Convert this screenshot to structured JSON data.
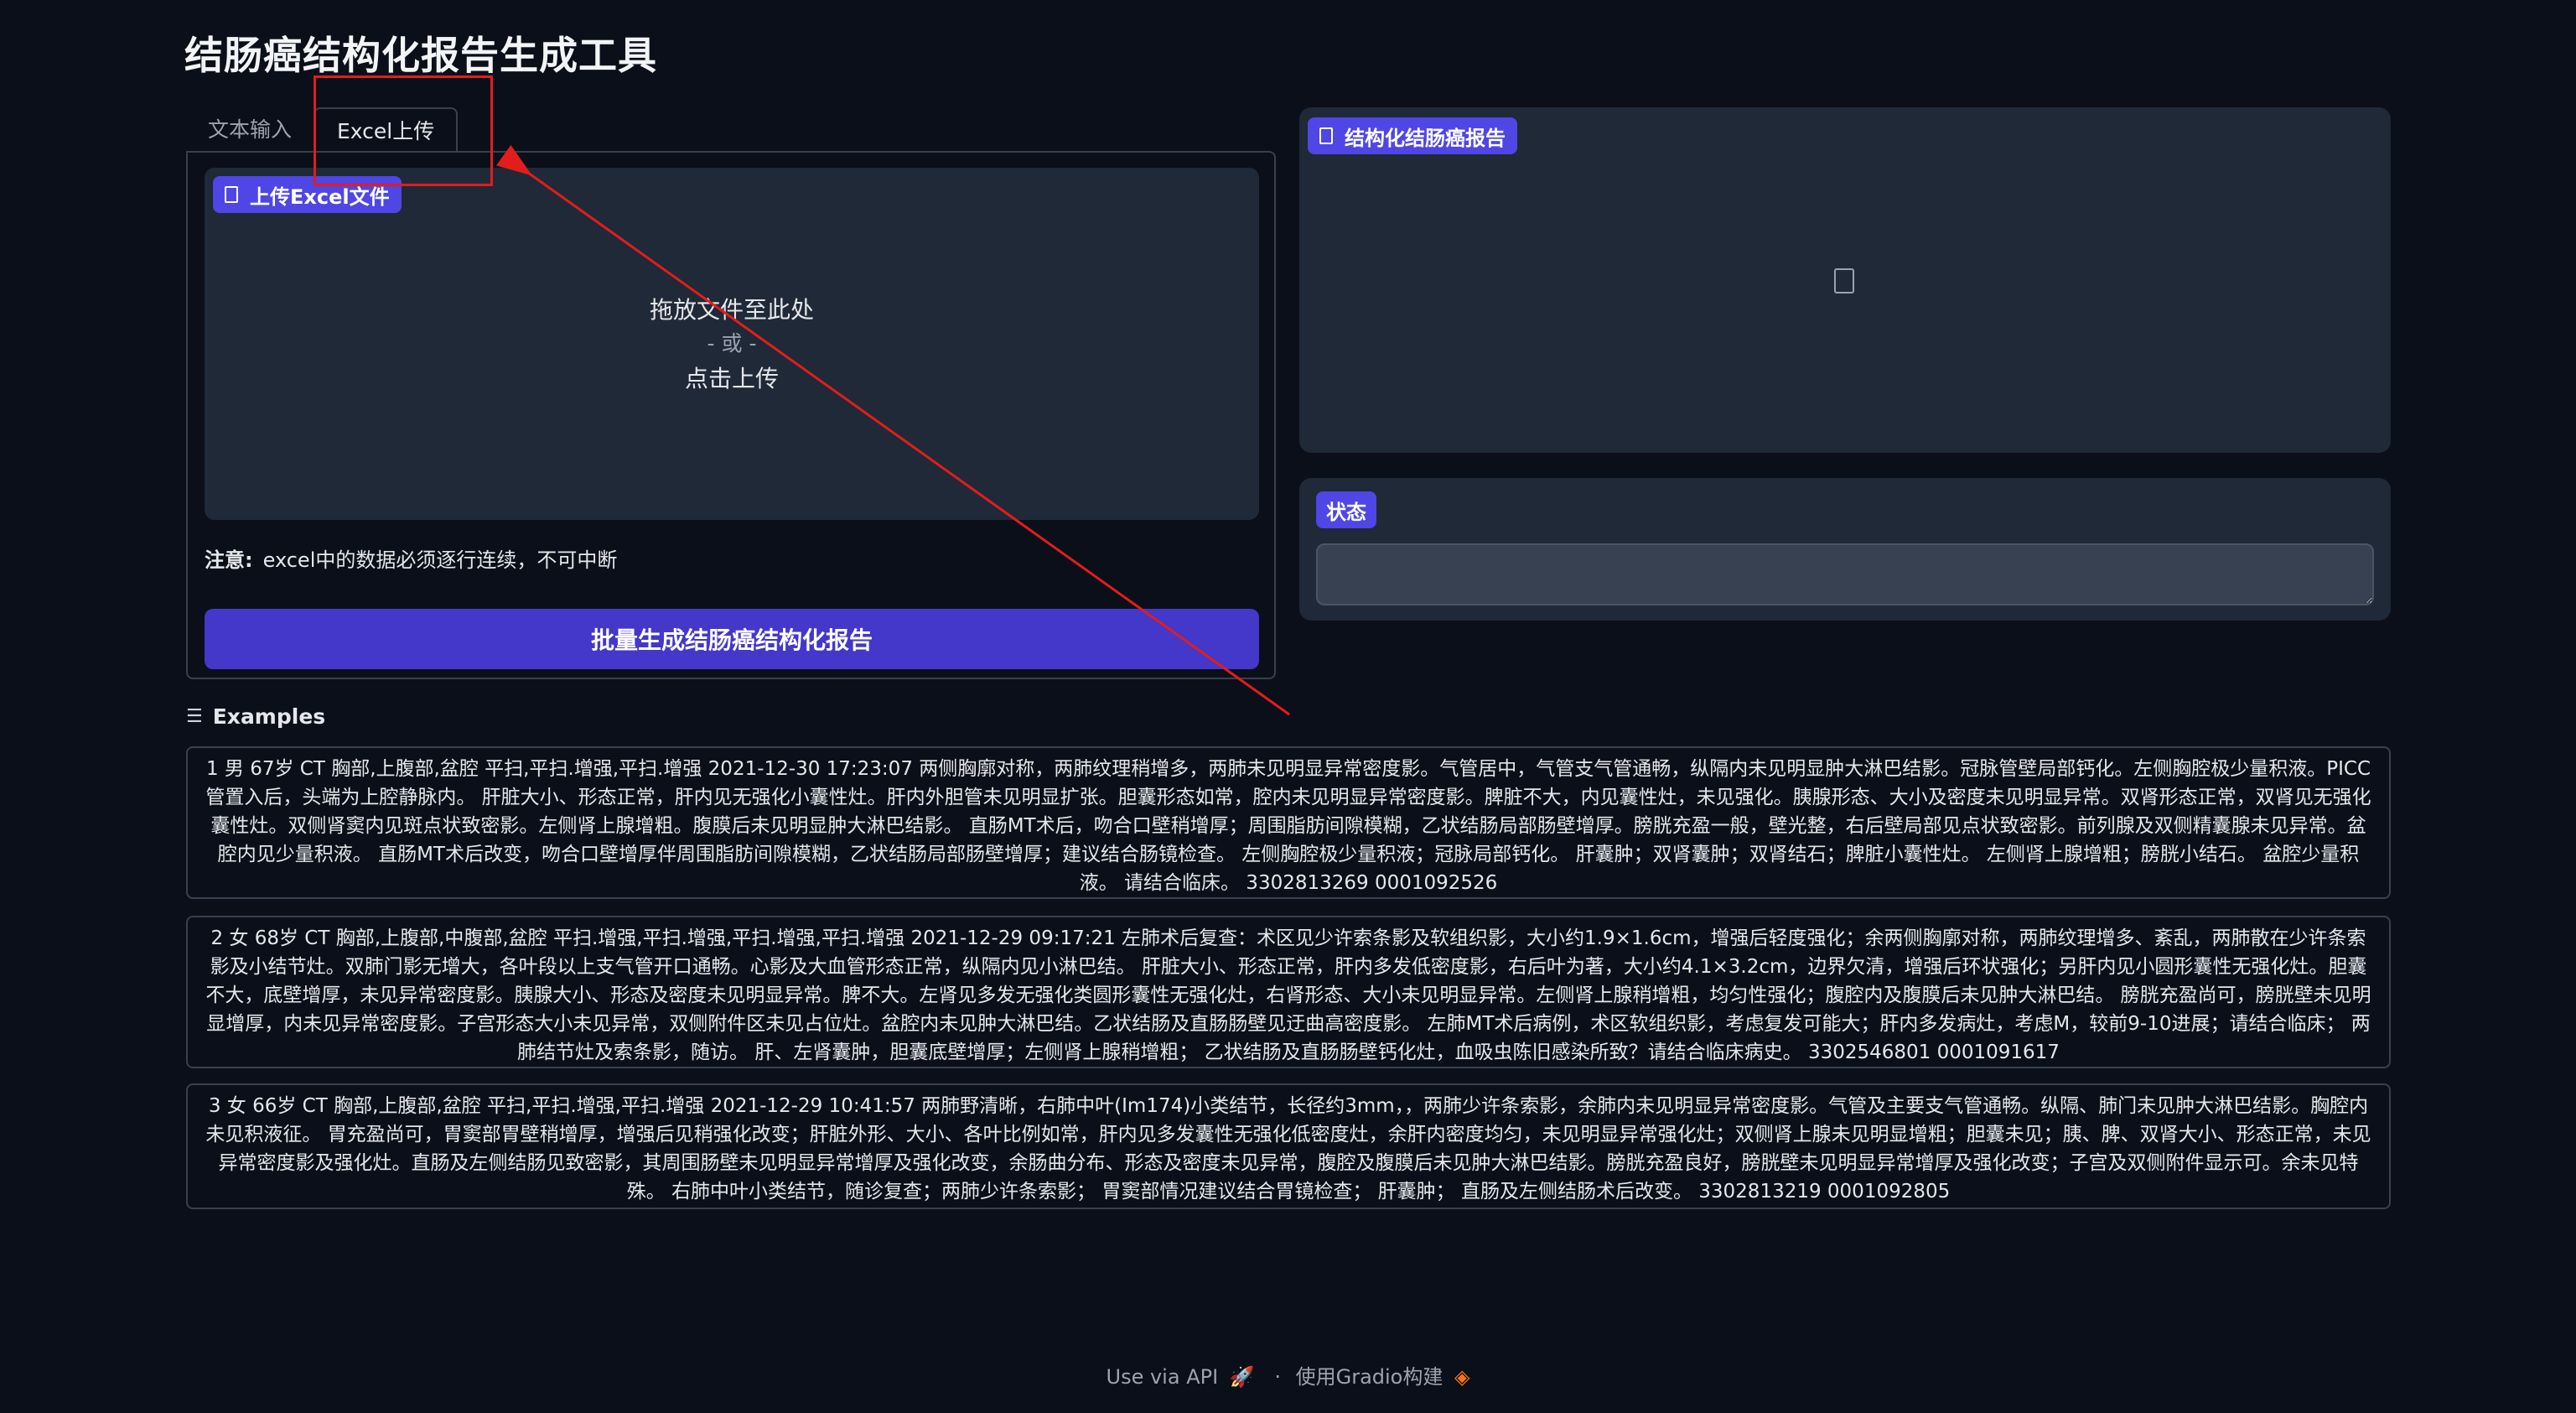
{
  "app": {
    "title": "结肠癌结构化报告生成工具"
  },
  "tabs": [
    {
      "label": "文本输入",
      "active": false
    },
    {
      "label": "Excel上传",
      "active": true
    }
  ],
  "upload": {
    "label": "上传Excel文件",
    "drop_text": "拖放文件至此处",
    "or_text": "- 或 -",
    "click_text": "点击上传"
  },
  "note": {
    "prefix": "注意:",
    "text": "excel中的数据必须逐行连续，不可中断"
  },
  "generate_button": "批量生成结肠癌结构化报告",
  "report": {
    "label": "结构化结肠癌报告"
  },
  "status": {
    "label": "状态",
    "value": ""
  },
  "examples": {
    "heading": "Examples",
    "items": [
      "1 男 67岁 CT 胸部,上腹部,盆腔 平扫,平扫.增强,平扫.增强 2021-12-30 17:23:07 两侧胸廓对称，两肺纹理稍增多，两肺未见明显异常密度影。气管居中，气管支气管通畅，纵隔内未见明显肿大淋巴结影。冠脉管壁局部钙化。左侧胸腔极少量积液。PICC管置入后，头端为上腔静脉内。 肝脏大小、形态正常，肝内见无强化小囊性灶。肝内外胆管未见明显扩张。胆囊形态如常，腔内未见明显异常密度影。脾脏不大，内见囊性灶，未见强化。胰腺形态、大小及密度未见明显异常。双肾形态正常，双肾见无强化囊性灶。双侧肾窦内见斑点状致密影。左侧肾上腺增粗。腹膜后未见明显肿大淋巴结影。 直肠MT术后，吻合口壁稍增厚；周围脂肪间隙模糊，乙状结肠局部肠壁增厚。膀胱充盈一般，壁光整，右后壁局部见点状致密影。前列腺及双侧精囊腺未见异常。盆腔内见少量积液。 直肠MT术后改变，吻合口壁增厚伴周围脂肪间隙模糊，乙状结肠局部肠壁增厚；建议结合肠镜检查。 左侧胸腔极少量积液；冠脉局部钙化。 肝囊肿；双肾囊肿；双肾结石；脾脏小囊性灶。 左侧肾上腺增粗；膀胱小结石。 盆腔少量积液。 请结合临床。 3302813269 0001092526",
      "2 女 68岁 CT 胸部,上腹部,中腹部,盆腔 平扫.增强,平扫.增强,平扫.增强,平扫.增强 2021-12-29 09:17:21 左肺术后复查：术区见少许索条影及软组织影，大小约1.9×1.6cm，增强后轻度强化；余两侧胸廓对称，两肺纹理增多、紊乱，两肺散在少许条索影及小结节灶。双肺门影无增大，各叶段以上支气管开口通畅。心影及大血管形态正常，纵隔内见小淋巴结。 肝脏大小、形态正常，肝内多发低密度影，右后叶为著，大小约4.1×3.2cm，边界欠清，增强后环状强化；另肝内见小圆形囊性无强化灶。胆囊不大，底壁增厚，未见异常密度影。胰腺大小、形态及密度未见明显异常。脾不大。左肾见多发无强化类圆形囊性无强化灶，右肾形态、大小未见明显异常。左侧肾上腺稍增粗，均匀性强化；腹腔内及腹膜后未见肿大淋巴结。 膀胱充盈尚可，膀胱壁未见明显增厚，内未见异常密度影。子宫形态大小未见异常，双侧附件区未见占位灶。盆腔内未见肿大淋巴结。乙状结肠及直肠肠壁见迂曲高密度影。 左肺MT术后病例，术区软组织影，考虑复发可能大；肝内多发病灶，考虑M，较前9-10进展；请结合临床； 两肺结节灶及索条影，随访。 肝、左肾囊肿，胆囊底壁增厚；左侧肾上腺稍增粗； 乙状结肠及直肠肠壁钙化灶，血吸虫陈旧感染所致？请结合临床病史。 3302546801 0001091617",
      "3 女 66岁 CT 胸部,上腹部,盆腔 平扫,平扫.增强,平扫.增强 2021-12-29 10:41:57 两肺野清晰，右肺中叶(Im174)小类结节，长径约3mm，，两肺少许条索影，余肺内未见明显异常密度影。气管及主要支气管通畅。纵隔、肺门未见肿大淋巴结影。胸腔内未见积液征。 胃充盈尚可，胃窦部胃壁稍增厚，增强后见稍强化改变；肝脏外形、大小、各叶比例如常，肝内见多发囊性无强化低密度灶，余肝内密度均匀，未见明显异常强化灶；双侧肾上腺未见明显增粗；胆囊未见；胰、脾、双肾大小、形态正常，未见异常密度影及强化灶。直肠及左侧结肠见致密影，其周围肠壁未见明显异常增厚及强化改变，余肠曲分布、形态及密度未见异常，腹腔及腹膜后未见肿大淋巴结影。膀胱充盈良好，膀胱壁未见明显异常增厚及强化改变；子宫及双侧附件显示可。余未见特殊。 右肺中叶小类结节，随诊复查；两肺少许条索影； 胃窦部情况建议结合胃镜检查； 肝囊肿； 直肠及左侧结肠术后改变。 3302813219 0001092805"
    ]
  },
  "footer": {
    "api_text": "Use via API",
    "separator": "·",
    "built_with": "使用Gradio构建"
  },
  "colors": {
    "background": "#0b0f19",
    "panel": "#1f2937",
    "accent": "#4f46e5",
    "button": "#4338ca",
    "annotation": "#e11d1d"
  }
}
